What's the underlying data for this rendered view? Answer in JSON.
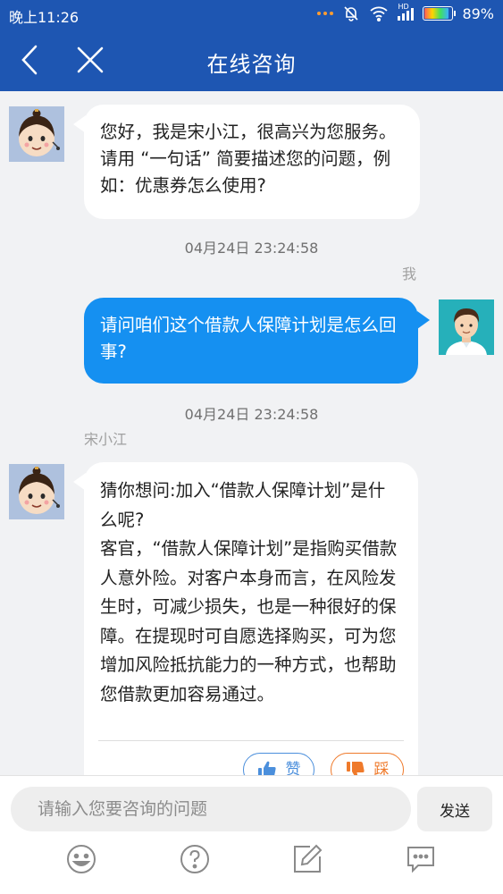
{
  "status_bar": {
    "time": "晚上11:26",
    "network": "HD",
    "battery": "89%"
  },
  "nav": {
    "title": "在线咨询",
    "back_icon": "chevron-left-icon",
    "close_icon": "close-icon"
  },
  "messages": [
    {
      "side": "left",
      "avatar": "agent-avatar",
      "text": "您好，我是宋小江，很高兴为您服务。请用 “一句话” 简要描述您的问题，例如：优惠券怎么使用?"
    },
    {
      "timestamp": "04月24日 23:24:58",
      "sender": "我",
      "side": "right",
      "avatar": "user-avatar",
      "text": "请问咱们这个借款人保障计划是怎么回事?"
    },
    {
      "timestamp": "04月24日 23:24:58",
      "sender": "宋小江",
      "side": "left",
      "avatar": "agent-avatar",
      "text_lines": [
        "猜你想问:加入“借款人保障计划”是什么呢?",
        "客官，“借款人保障计划”是指购买借款人意外险。对客户本身而言，在风险发生时，可减少损失，也是一种很好的保障。在提现时可自愿选择购买，可为您增加风险抵抗能力的一种方式，也帮助您借款更加容易通过。"
      ],
      "feedback": {
        "like_label": "赞",
        "dislike_label": "踩"
      }
    }
  ],
  "input": {
    "placeholder": "请输入您要咨询的问题",
    "send_label": "发送"
  },
  "toolbar": [
    "emoji-icon",
    "question-icon",
    "edit-icon",
    "comment-icon"
  ],
  "colors": {
    "header": "#1e56b2",
    "user_bubble": "#1590f1",
    "agent_bubble": "#ffffff",
    "background": "#f1f2f4",
    "like": "#4b8fdc",
    "dislike": "#ef7a2b"
  }
}
